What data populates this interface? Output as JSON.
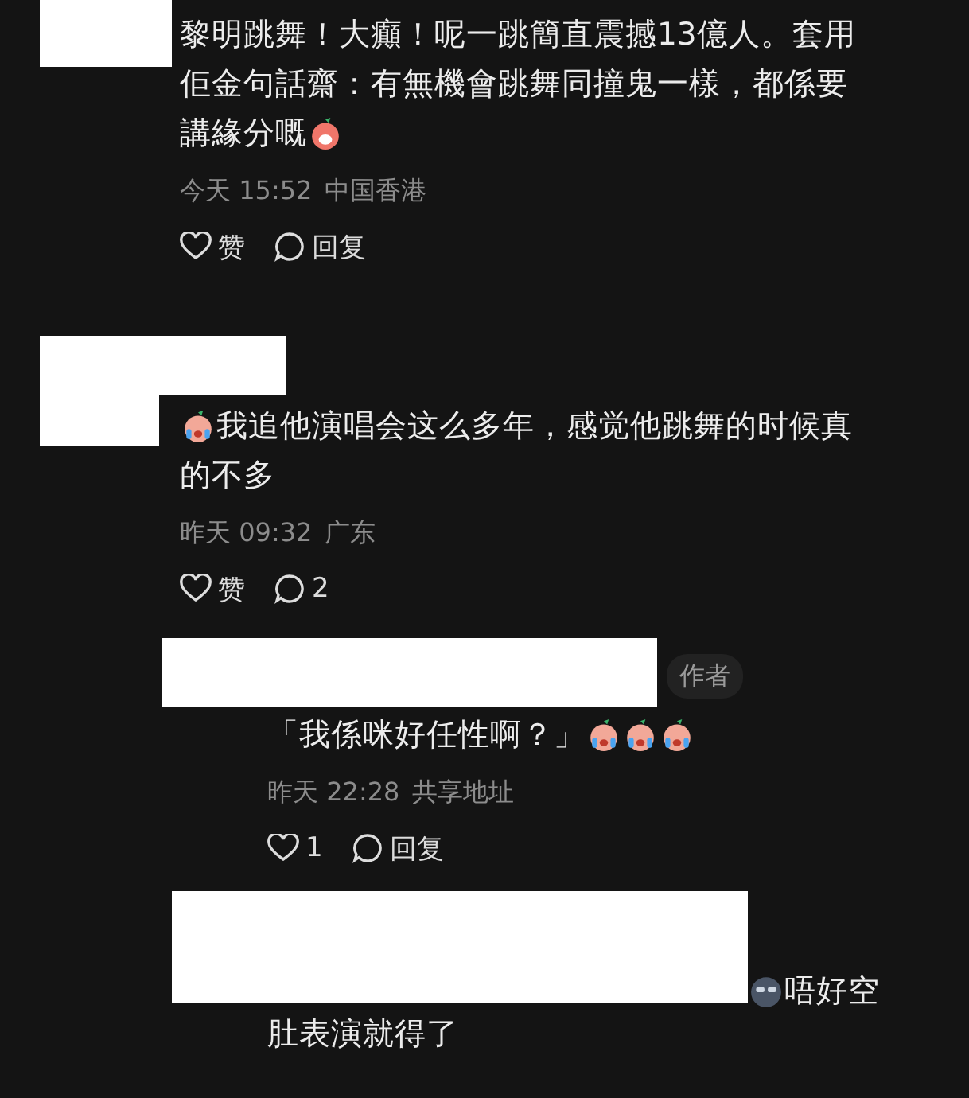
{
  "comments": [
    {
      "lines": [
        "黎明跳舞！大癲！呢一跳簡直震撼13億人。套用",
        "佢金句話齋：有無機會跳舞同撞鬼一樣，都係要",
        "講緣分嘅"
      ],
      "emoji_after": [
        {
          "kind": "laughing"
        }
      ],
      "time": "今天 15:52",
      "location": "中国香港",
      "like_label": "赞",
      "reply_label": "回复"
    },
    {
      "lines": [
        "我追他演唱会这么多年，感觉他跳舞的时候真",
        "的不多"
      ],
      "emoji_before": [
        {
          "kind": "crying"
        }
      ],
      "time": "昨天 09:32",
      "location": "广东",
      "like_label": "赞",
      "reply_label": "2",
      "replies": [
        {
          "badge": "作者",
          "lines": [
            "「我係咪好任性啊？」"
          ],
          "emoji_after": [
            {
              "kind": "crying"
            },
            {
              "kind": "crying"
            },
            {
              "kind": "crying"
            }
          ],
          "time": "昨天 22:28",
          "location": "共享地址",
          "like_label": "1",
          "reply_label": "回复"
        },
        {
          "lines": [
            "唔好空",
            "肚表演就得了"
          ],
          "emoji_before": [
            {
              "kind": "cool"
            }
          ]
        }
      ]
    }
  ]
}
